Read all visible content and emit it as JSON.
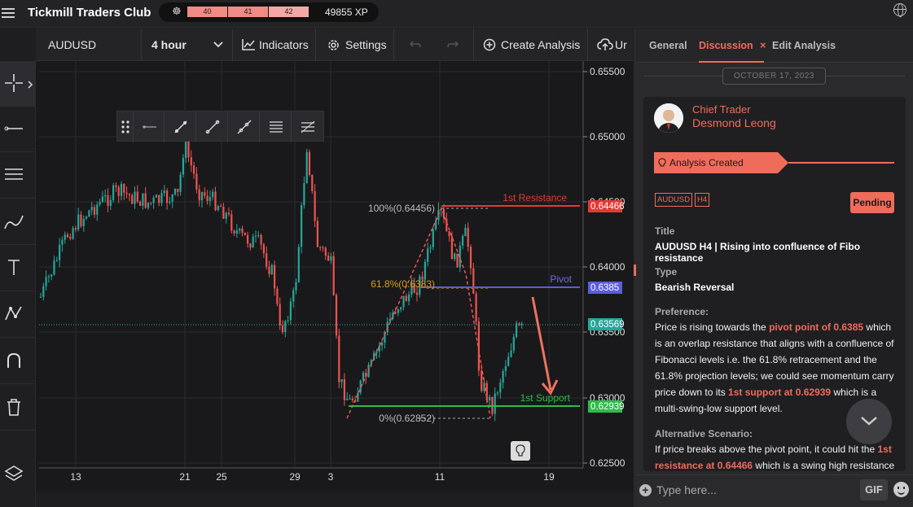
{
  "topbar": {
    "title": "Tickmill Traders Club",
    "xp_levels": [
      "40",
      "41",
      "42"
    ],
    "xp_total": "49855 XP"
  },
  "toolbar": {
    "symbol": "AUDUSD",
    "interval": "4 hour",
    "indicators": "Indicators",
    "settings": "Settings",
    "create": "Create Analysis",
    "upload": "Ur"
  },
  "chart": {
    "price_labels": [
      "0.65500",
      "0.65000",
      "0.64500",
      "0.64000",
      "0.63500",
      "0.63000",
      "0.62500"
    ],
    "date_labels": [
      "13",
      "21",
      "25",
      "29",
      "3",
      "11",
      "19"
    ],
    "resistance": {
      "label": "1st Resistance",
      "value": "0.64466"
    },
    "pivot": {
      "label": "Pivot",
      "value": "0.6385"
    },
    "current": "0.63569",
    "support": {
      "label": "1st Support",
      "value": "0.62939"
    },
    "fib_100": "100%(0.64456)",
    "fib_618": "61.8%(0.6383)",
    "fib_0": "0%(0.62852)",
    "colors": {
      "up": "#26a69a",
      "down": "#ef5350",
      "resistance": "#e53935",
      "pivot": "#5c5ce0",
      "support": "#2bbd4a",
      "fib": "#d4a017"
    }
  },
  "panel": {
    "tabs": [
      "General",
      "Discussion",
      "Edit Analysis"
    ],
    "date": "OCTOBER 17, 2023",
    "role": "Chief Trader",
    "name": "Desmond Leong",
    "banner": "Analysis Created",
    "tags": [
      "AUDUSD",
      "H4"
    ],
    "status": "Pending",
    "title_label": "Title",
    "title_value": "AUDUSD H4 | Rising into confluence of Fibo resistance",
    "type_label": "Type",
    "type_value": "Bearish Reversal",
    "pref_label": "Preference:",
    "pref_1": "Price is rising towards the ",
    "pref_hl1": "pivot point of 0.6385",
    "pref_2": " which is an overlap resistance that aligns with a confluence of Fibonacci levels i.e. the 61.8% retracement and the 61.8% projection levels; we could see momentum carry price down to its ",
    "pref_hl2": "1st support at 0.62939",
    "pref_3": " which is a multi-swing-low support level.",
    "alt_label": "Alternative Scenario:",
    "alt_1": "If price breaks above the pivot point, it could hit the ",
    "alt_hl": "1st resistance at 0.64466",
    "alt_2": " which is a swing high resistance",
    "input_placeholder": "Type here...",
    "gif": "GIF"
  }
}
